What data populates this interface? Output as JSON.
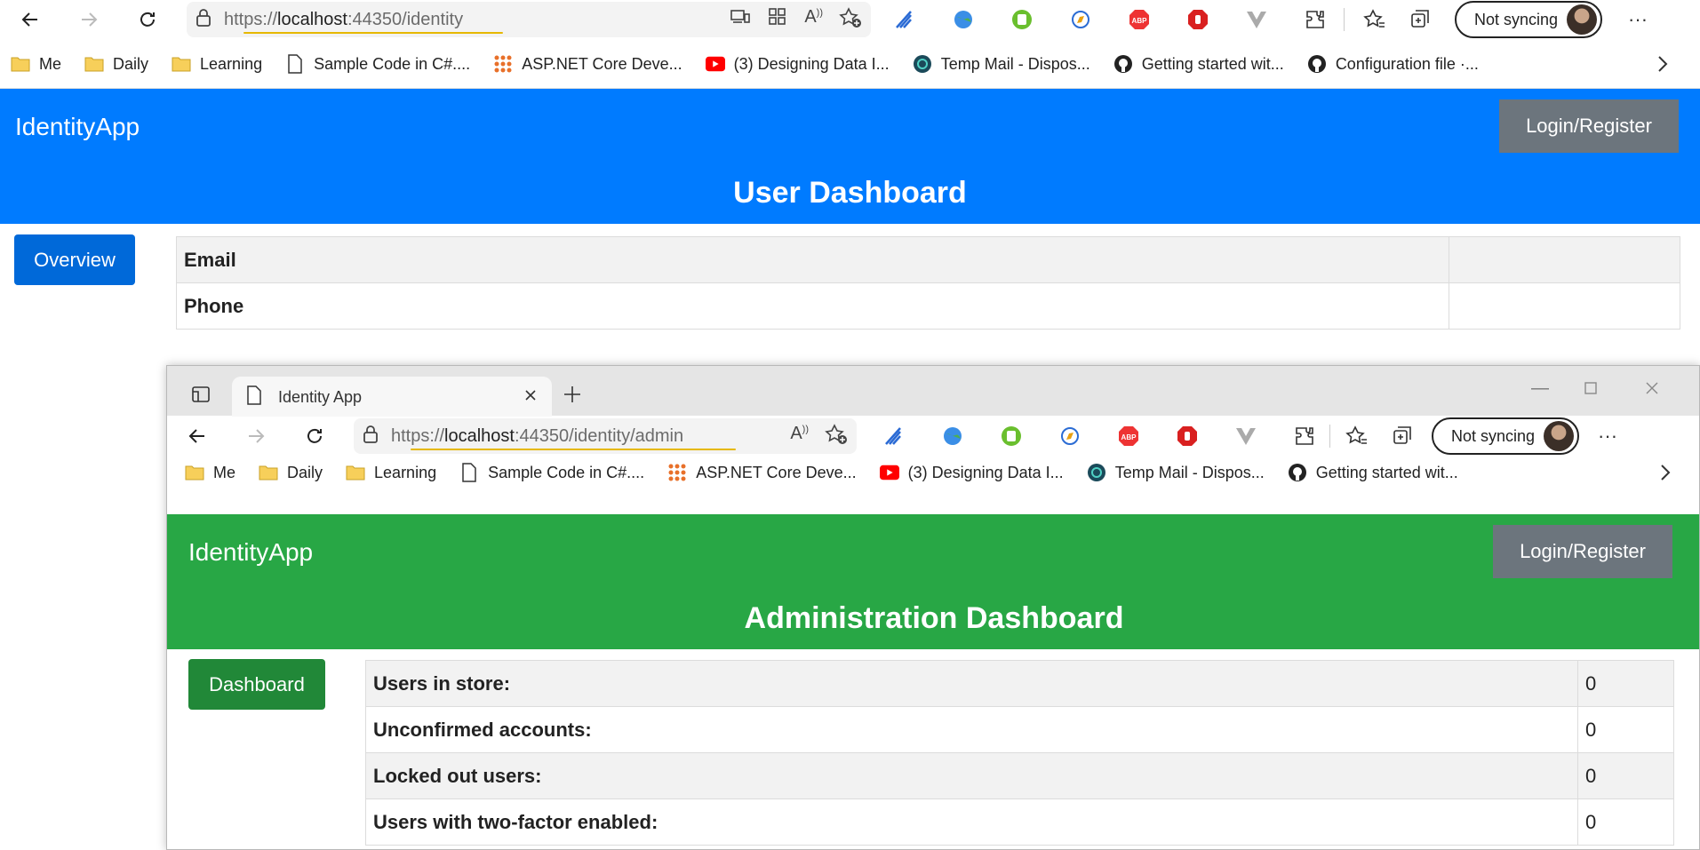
{
  "browser": {
    "url_scheme": "https://",
    "url_host": "localhost",
    "url_rest": ":44350/identity",
    "sync_label": "Not syncing"
  },
  "favorites": [
    "Me",
    "Daily",
    "Learning",
    "Sample Code in C#....",
    "ASP.NET Core Deve...",
    "(3) Designing Data I...",
    "Temp Mail - Dispos...",
    "Getting started wit...",
    "Configuration file ·..."
  ],
  "user_app": {
    "brand": "IdentityApp",
    "login_label": "Login/Register",
    "title": "User Dashboard",
    "sidebar_button": "Overview",
    "rows": [
      {
        "label": "Email",
        "value": ""
      },
      {
        "label": "Phone",
        "value": ""
      }
    ],
    "colors": {
      "header": "#007bff",
      "button": "#0069d9"
    }
  },
  "second_window": {
    "tab_title": "Identity App",
    "url_scheme": "https://",
    "url_host": "localhost",
    "url_rest": ":44350/identity/admin",
    "sync_label": "Not syncing",
    "favorites": [
      "Me",
      "Daily",
      "Learning",
      "Sample Code in C#....",
      "ASP.NET Core Deve...",
      "(3) Designing Data I...",
      "Temp Mail - Dispos...",
      "Getting started wit..."
    ],
    "app": {
      "brand": "IdentityApp",
      "login_label": "Login/Register",
      "title": "Administration Dashboard",
      "sidebar_button": "Dashboard",
      "rows": [
        {
          "label": "Users in store:",
          "value": "0"
        },
        {
          "label": "Unconfirmed accounts:",
          "value": "0"
        },
        {
          "label": "Locked out users:",
          "value": "0"
        },
        {
          "label": "Users with two-factor enabled:",
          "value": "0"
        }
      ],
      "colors": {
        "header": "#28a745",
        "button": "#218838"
      }
    }
  }
}
